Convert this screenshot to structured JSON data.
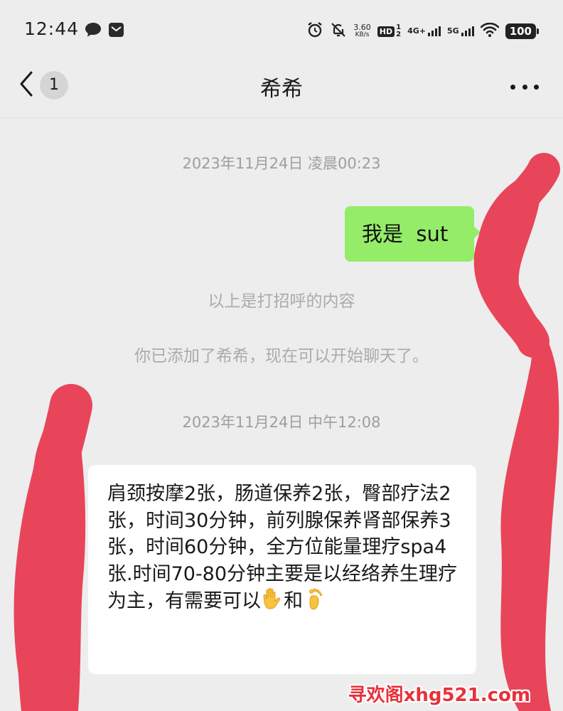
{
  "status_bar": {
    "time": "12:44",
    "net_speed_value": "3.60",
    "net_speed_unit": "KB/s",
    "hd_label": "HD",
    "hd_sub": "1",
    "hd_sub2": "2",
    "signal_4g": "4G+",
    "signal_5g": "5G",
    "battery": "100",
    "icons": [
      "chat-bubble-icon",
      "mail-icon",
      "alarm-icon",
      "mute-icon",
      "wifi-icon",
      "battery-icon"
    ]
  },
  "header": {
    "title": "希希",
    "unread_count": "1",
    "back_icon": "chevron-left-icon",
    "more_icon": "more-icon"
  },
  "messages": {
    "timestamp_1": "2023年11月24日 凌晨00:23",
    "outgoing_text": "我是  sut",
    "system_1": "以上是打招呼的内容",
    "system_2": "你已添加了希希，现在可以开始聊天了。",
    "timestamp_2": "2023年11月24日 中午12:08",
    "incoming_text": "肩颈按摩2张，肠道保养2张，臀部疗法2张，时间30分钟，前列腺保养肾部保养3张，时间60分钟，全方位能量理疗spa4张.时间70-80分钟主要是以经络养生理疗为主，有需要可以",
    "incoming_join": "和",
    "incoming_emojis": [
      "raised-hand-icon",
      "foot-icon"
    ]
  },
  "watermark": {
    "text": "寻欢阁xhg521.com"
  },
  "colors": {
    "background": "#ededed",
    "outgoing_bubble": "#95ec69",
    "incoming_bubble": "#ffffff",
    "redaction": "#e8455a",
    "watermark": "#e8313a"
  }
}
